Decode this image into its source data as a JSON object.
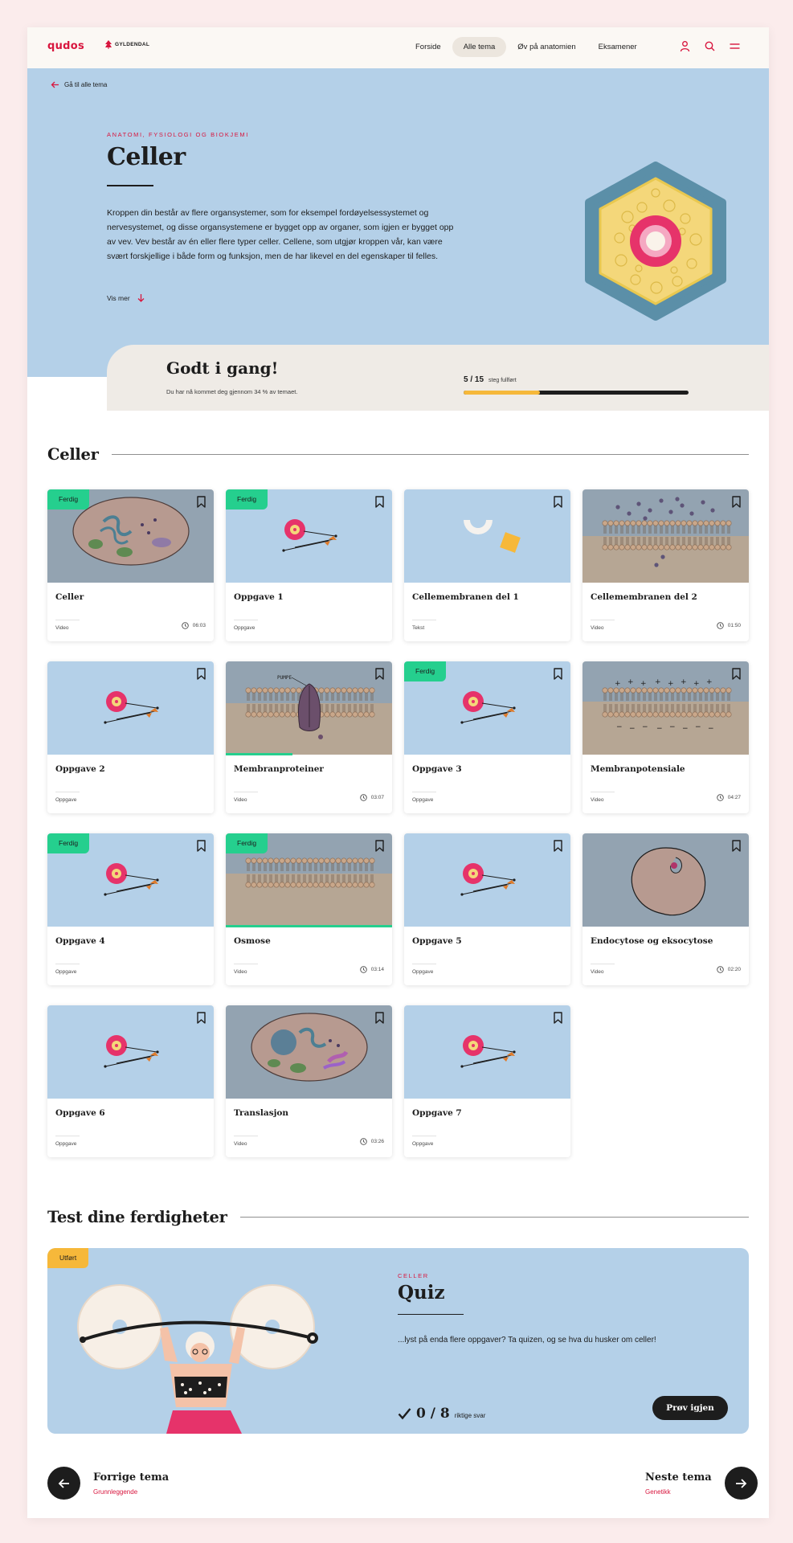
{
  "header": {
    "brand": "qudos",
    "partner": "GYLDENDAL",
    "nav": [
      {
        "label": "Forside",
        "active": false
      },
      {
        "label": "Alle tema",
        "active": true
      },
      {
        "label": "Øv på anatomien",
        "active": false
      },
      {
        "label": "Eksamener",
        "active": false
      }
    ],
    "icons": [
      "user-icon",
      "search-icon",
      "menu-icon"
    ]
  },
  "hero": {
    "back_label": "Gå til alle tema",
    "eyebrow": "ANATOMI, FYSIOLOGI OG BIOKJEMI",
    "title": "Celler",
    "text": "Kroppen din består av flere organsystemer, som for eksempel fordøyelsessystemet og nervesystemet, og disse organsystemene er bygget opp av organer, som igjen er bygget opp av vev. Vev består av én eller flere typer celler. Cellene, som utgjør kroppen vår, kan være svært forskjellige i både form og funksjon, men de har likevel en del egenskaper til felles.",
    "more_label": "Vis mer"
  },
  "progress": {
    "title": "Godt i gang!",
    "subtitle": "Du har nå kommet deg gjennom 34 % av temaet.",
    "count": "5 / 15",
    "count_label": "steg fullført",
    "fraction": 0.34
  },
  "section": {
    "title": "Celler"
  },
  "cards": [
    {
      "title": "Celler",
      "type": "Video",
      "duration": "06:03",
      "badge": "Ferdig",
      "thumb": "cell",
      "progress": 0
    },
    {
      "title": "Oppgave 1",
      "type": "Oppgave",
      "duration": "",
      "badge": "Ferdig",
      "thumb": "task",
      "progress": 0
    },
    {
      "title": "Cellemembranen del 1",
      "type": "Tekst",
      "duration": "",
      "badge": "",
      "thumb": "shapes",
      "progress": 0
    },
    {
      "title": "Cellemembranen del 2",
      "type": "Video",
      "duration": "01:50",
      "badge": "",
      "thumb": "membrane-dots",
      "progress": 0
    },
    {
      "title": "Oppgave 2",
      "type": "Oppgave",
      "duration": "",
      "badge": "",
      "thumb": "task",
      "progress": 0
    },
    {
      "title": "Membranproteiner",
      "type": "Video",
      "duration": "03:07",
      "badge": "",
      "thumb": "protein",
      "progress": 0.4
    },
    {
      "title": "Oppgave 3",
      "type": "Oppgave",
      "duration": "",
      "badge": "Ferdig",
      "thumb": "task",
      "progress": 0
    },
    {
      "title": "Membranpotensiale",
      "type": "Video",
      "duration": "04:27",
      "badge": "",
      "thumb": "membrane-charge",
      "progress": 0
    },
    {
      "title": "Oppgave 4",
      "type": "Oppgave",
      "duration": "",
      "badge": "Ferdig",
      "thumb": "task",
      "progress": 0
    },
    {
      "title": "Osmose",
      "type": "Video",
      "duration": "03:14",
      "badge": "Ferdig",
      "thumb": "membrane",
      "progress": 1
    },
    {
      "title": "Oppgave 5",
      "type": "Oppgave",
      "duration": "",
      "badge": "",
      "thumb": "task",
      "progress": 0
    },
    {
      "title": "Endocytose og eksocytose",
      "type": "Video",
      "duration": "02:20",
      "badge": "",
      "thumb": "endo",
      "progress": 0
    },
    {
      "title": "Oppgave 6",
      "type": "Oppgave",
      "duration": "",
      "badge": "",
      "thumb": "task",
      "progress": 0
    },
    {
      "title": "Translasjon",
      "type": "Video",
      "duration": "03:26",
      "badge": "",
      "thumb": "cell2",
      "progress": 0
    },
    {
      "title": "Oppgave 7",
      "type": "Oppgave",
      "duration": "",
      "badge": "",
      "thumb": "task",
      "progress": 0
    }
  ],
  "test_section": {
    "title": "Test dine ferdigheter"
  },
  "quiz": {
    "badge": "Utført",
    "eyebrow": "CELLER",
    "title": "Quiz",
    "text": "...lyst på enda flere oppgaver? Ta quizen, og se hva du husker om celler!",
    "score": "0 / 8",
    "score_label": "riktige svar",
    "button": "Prøv igjen"
  },
  "prev": {
    "title": "Forrige tema",
    "subtitle": "Grunnleggende"
  },
  "next": {
    "title": "Neste tema",
    "subtitle": "Genetikk"
  },
  "colors": {
    "accent": "#d8163e",
    "hero_bg": "#b4d0e8",
    "done": "#25cf8e",
    "progress": "#f6b83a",
    "dark": "#1d1d1d"
  }
}
